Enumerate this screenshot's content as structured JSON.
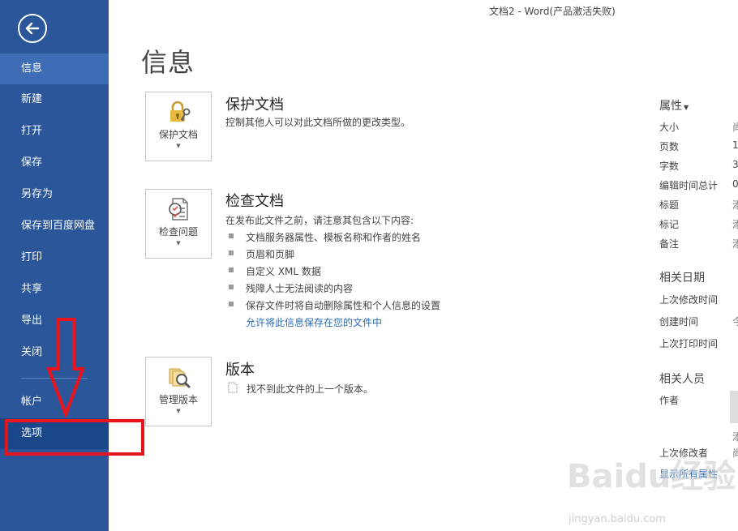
{
  "window": {
    "title": "文档2 - Word(产品激活失败)"
  },
  "sidebar": {
    "items": [
      {
        "label": "信息"
      },
      {
        "label": "新建"
      },
      {
        "label": "打开"
      },
      {
        "label": "保存"
      },
      {
        "label": "另存为"
      },
      {
        "label": "保存到百度网盘"
      },
      {
        "label": "打印"
      },
      {
        "label": "共享"
      },
      {
        "label": "导出"
      },
      {
        "label": "关闭"
      }
    ],
    "account": {
      "label": "帐户"
    },
    "options": {
      "label": "选项"
    }
  },
  "page": {
    "title": "信息"
  },
  "protect": {
    "tile_label": "保护文档",
    "title": "保护文档",
    "desc": "控制其他人可以对此文档所做的更改类型。"
  },
  "inspect": {
    "tile_label": "检查问题",
    "title": "检查文档",
    "desc": "在发布此文件之前，请注意其包含以下内容:",
    "bullets": [
      "文档服务器属性、模板名称和作者的姓名",
      "页眉和页脚",
      "自定义 XML 数据",
      "残障人士无法阅读的内容",
      "保存文件时将自动删除属性和个人信息的设置"
    ],
    "link": "允许将此信息保存在您的文件中"
  },
  "versions": {
    "tile_label": "管理版本",
    "title": "版本",
    "desc": "找不到此文件的上一个版本。"
  },
  "properties": {
    "header": "属性",
    "items": [
      {
        "label": "大小",
        "value": "尚"
      },
      {
        "label": "页数",
        "value": "1"
      },
      {
        "label": "字数",
        "value": "3"
      },
      {
        "label": "编辑时间总计",
        "value": "0"
      },
      {
        "label": "标题",
        "value": "添"
      },
      {
        "label": "标记",
        "value": "添"
      },
      {
        "label": "备注",
        "value": "添"
      }
    ],
    "dates_header": "相关日期",
    "dates": [
      {
        "label": "上次修改时间",
        "value": ""
      },
      {
        "label": "创建时间",
        "value": "今"
      },
      {
        "label": "上次打印时间",
        "value": ""
      }
    ],
    "people_header": "相关人员",
    "author_label": "作者",
    "author_value": "添",
    "last_modified_by_label": "上次修改者",
    "last_modified_by_value": "尚",
    "show_all_link": "显示所有属性"
  },
  "watermark": {
    "text": "Baidu经验",
    "sub": "jingyan.baidu.com"
  },
  "colors": {
    "sidebar_bg": "#2b579a",
    "sidebar_active": "#3e6db5",
    "sidebar_selected": "#19478a",
    "link": "#2b6cb5",
    "annotation": "#e8141c"
  },
  "icons": {
    "back": "back-arrow-icon",
    "protect": "lock-key-icon",
    "inspect": "inspect-document-icon",
    "versions": "manage-versions-icon",
    "note": "document-page-icon"
  }
}
